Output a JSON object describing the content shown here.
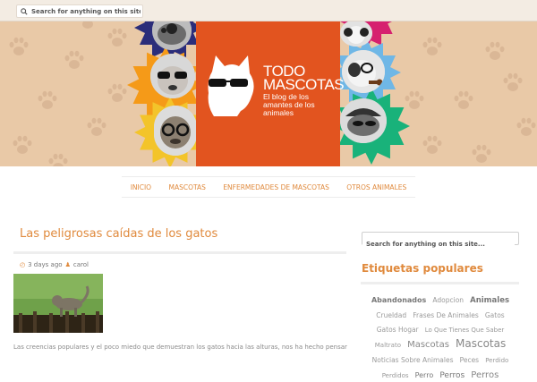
{
  "search": {
    "placeholder": "Search for anything on this site..."
  },
  "logo": {
    "line1": "TODO",
    "line2": "MASCOTAS",
    "subtitle": "El blog de los amantes de los animales"
  },
  "nav": {
    "items": [
      {
        "label": "INICIO"
      },
      {
        "label": "MASCOTAS"
      },
      {
        "label": "ENFERMEDADES DE MASCOTAS"
      },
      {
        "label": "OTROS ANIMALES"
      }
    ]
  },
  "post": {
    "title": "Las peligrosas caídas de los gatos",
    "date": "3 days ago",
    "author": "carol",
    "excerpt": "Las creencias populares y el poco miedo que demuestran los gatos hacia las alturas, nos ha hecho pensar"
  },
  "sidebar": {
    "search_placeholder": "Search for anything on this site...",
    "tags_title": "Etiquetas populares",
    "tags": [
      {
        "label": "Abandonados",
        "size": 8,
        "bold": true,
        "color": "#777777"
      },
      {
        "label": "Adopcion",
        "size": 7.5,
        "color": "#9a9a9a"
      },
      {
        "label": "Animales",
        "size": 8.5,
        "bold": true,
        "color": "#777777"
      },
      {
        "label": "Crueldad",
        "size": 7.5,
        "color": "#9a9a9a"
      },
      {
        "label": "Frases De Animales",
        "size": 7.5,
        "color": "#9a9a9a"
      },
      {
        "label": "Gatos",
        "size": 7.5,
        "color": "#9a9a9a"
      },
      {
        "label": "Gatos Hogar",
        "size": 7.5,
        "color": "#9a9a9a"
      },
      {
        "label": "Lo Que Tienes Que Saber",
        "size": 7,
        "color": "#9a9a9a"
      },
      {
        "label": "Maltrato",
        "size": 7,
        "color": "#9a9a9a"
      },
      {
        "label": "Mascotas",
        "size": 10,
        "color": "#888888"
      },
      {
        "label": "Mascotas",
        "size": 12,
        "color": "#888888"
      },
      {
        "label": "Noticias Sobre Animales",
        "size": 7.5,
        "color": "#9a9a9a"
      },
      {
        "label": "Peces",
        "size": 7.5,
        "color": "#9a9a9a"
      },
      {
        "label": "Perdido",
        "size": 7,
        "color": "#9a9a9a"
      },
      {
        "label": "Perdidos",
        "size": 7,
        "color": "#9a9a9a"
      },
      {
        "label": "Perro",
        "size": 8,
        "color": "#777777"
      },
      {
        "label": "Perros",
        "size": 9,
        "color": "#777777"
      },
      {
        "label": "Perros",
        "size": 10,
        "color": "#888888"
      }
    ]
  },
  "colors": {
    "accent": "#e08a3d",
    "banner_bg": "#e9c9a7",
    "logo_panel": "#e2541f"
  }
}
